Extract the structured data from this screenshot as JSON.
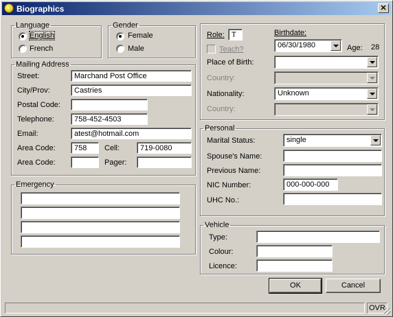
{
  "window": {
    "title": "Biographics",
    "close_glyph": "✕",
    "icon": "app-icon"
  },
  "language": {
    "legend": "Language",
    "options": [
      {
        "label": "English",
        "selected": true
      },
      {
        "label": "French",
        "selected": false
      }
    ]
  },
  "gender": {
    "legend": "Gender",
    "options": [
      {
        "label": "Female",
        "selected": true
      },
      {
        "label": "Male",
        "selected": false
      }
    ]
  },
  "mailing": {
    "legend": "Mailing Address",
    "street_label": "Street:",
    "street": "Marchand Post Office",
    "city_label": "City/Prov:",
    "city": "Castries",
    "postal_label": "Postal Code:",
    "postal": "",
    "telephone_label": "Telephone:",
    "telephone": "758-452-4503",
    "email_label": "Email:",
    "email": "atest@hotmail.com",
    "areacode1_label": "Area Code:",
    "areacode1": "758",
    "cell_label": "Cell:",
    "cell": "719-0080",
    "areacode2_label": "Area Code:",
    "areacode2": "",
    "pager_label": "Pager:",
    "pager": ""
  },
  "emergency": {
    "legend": "Emergency",
    "lines": [
      "",
      "",
      "",
      ""
    ]
  },
  "role": {
    "role_label": "Role:",
    "role_value": "T",
    "teach_label": "Teach?",
    "teach_checked": false,
    "birthdate_label": "Birthdate:",
    "birthdate": "06/30/1980",
    "age_label": "Age:",
    "age": "28",
    "pob_label": "Place of Birth:",
    "pob": "",
    "country1_label": "Country:",
    "country1": "",
    "nationality_label": "Nationality:",
    "nationality": "Unknown",
    "country2_label": "Country:",
    "country2": ""
  },
  "personal": {
    "legend": "Personal",
    "marital_label": "Marital Status:",
    "marital": "single",
    "spouse_label": "Spouse's Name:",
    "spouse": "",
    "prevname_label": "Previous Name:",
    "prevname": "",
    "nic_label": "NIC Number:",
    "nic": "000-000-000",
    "uhc_label": "UHC No.:",
    "uhc": ""
  },
  "vehicle": {
    "legend": "Vehicle",
    "type_label": "Type:",
    "type": "",
    "colour_label": "Colour:",
    "colour": "",
    "licence_label": "Licence:",
    "licence": ""
  },
  "buttons": {
    "ok": "OK",
    "cancel": "Cancel"
  },
  "statusbar": {
    "left": "",
    "right": "OVR"
  }
}
